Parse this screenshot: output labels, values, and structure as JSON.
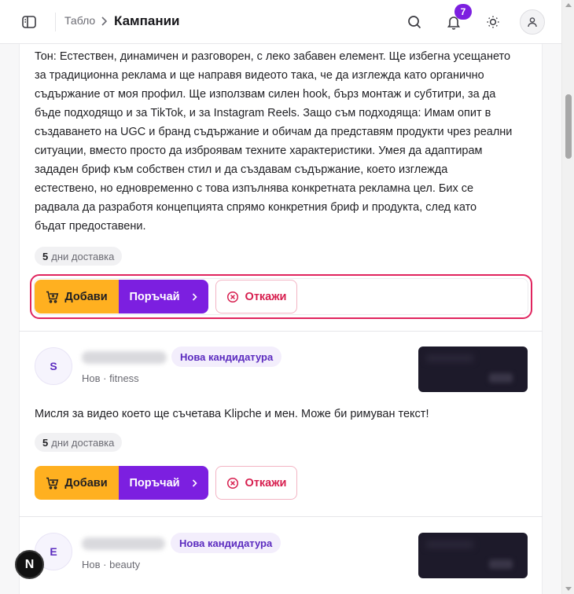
{
  "header": {
    "breadcrumb_parent": "Табло",
    "title": "Кампании",
    "notification_count": "7"
  },
  "cards": [
    {
      "description_lines": [
        "Тон: Естествен, динамичен и разговорен, с леко забавен елемент. Ще избегна усещането",
        "за традиционна реклама и ще направя видеото така, че да изглежда като органично",
        "съдържание от моя профил. Ще използвам силен hook, бърз монтаж и субтитри, за да",
        "бъде подходящо и за TikTok, и за Instagram Reels. Защо съм подходяща: Имам опит в",
        "създаването на UGC и бранд съдържание и обичам да представям продукти чрез реални",
        "ситуации, вместо просто да изброявам техните характеристики. Умея да адаптирам",
        "зададен бриф към собствен стил и да създавам съдържание, което изглежда",
        "естествено, но едновременно с това изпълнява конкретната рекламна цел. Бих се",
        "радвала да разработя концепцията спрямо конкретния бриф и продукта, след като",
        "бъдат предоставени."
      ],
      "delivery_days": "5",
      "delivery_label": "дни доставка"
    },
    {
      "initial": "S",
      "badge": "Нова кандидатура",
      "status": "Нов",
      "category": "· fitness",
      "message": "Мисля за видео което ще съчетава Klipche и мен. Може би римуван текст!",
      "delivery_days": "5",
      "delivery_label": "дни доставка"
    },
    {
      "initial": "E",
      "badge": "Нова кандидатура",
      "status": "Нов",
      "category": "· beauty"
    }
  ],
  "actions": {
    "add_label": "Добави",
    "order_label": "Поръчай",
    "reject_label": "Откажи"
  },
  "colors": {
    "accent": "#7c1fe0",
    "add_button": "#ffb020",
    "reject": "#d71f4f",
    "focus_ring": "#e0245e"
  },
  "icons": {
    "sidebar": "sidebar-toggle-icon",
    "search": "search-icon",
    "bell": "bell-icon",
    "theme": "sun-icon",
    "user": "user-icon",
    "cart": "cart-plus-icon",
    "chevron": "chevron-right-icon",
    "reject": "x-circle-icon"
  },
  "dev_badge": "N"
}
